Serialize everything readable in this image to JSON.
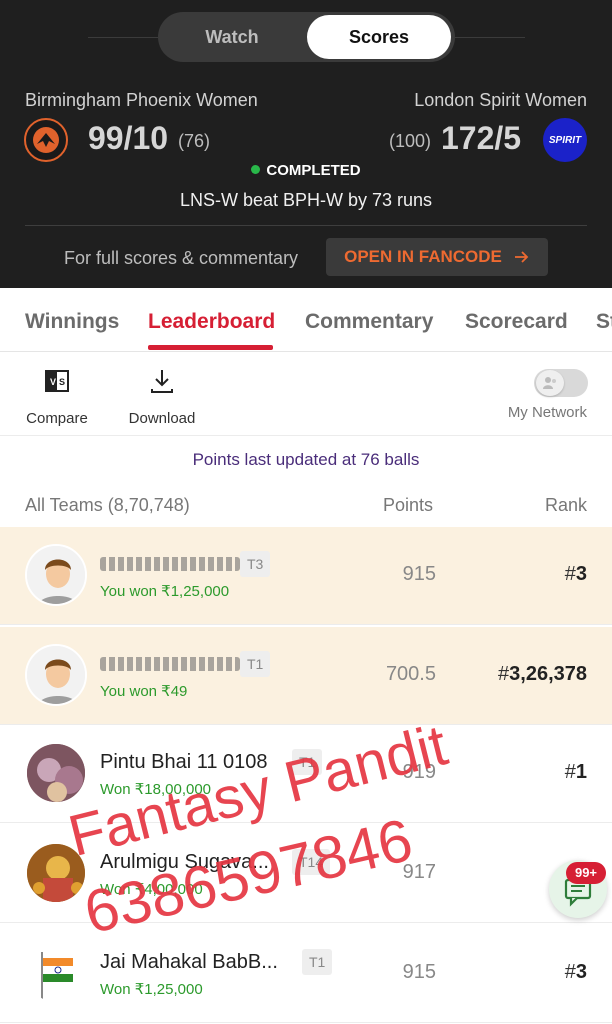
{
  "toggle": {
    "watch": "Watch",
    "scores": "Scores"
  },
  "match": {
    "team1": {
      "name": "Birmingham Phoenix Women",
      "score": "99/10",
      "overs": "(76)",
      "logo_text": "BIRMINGHAM PHOENIX"
    },
    "team2": {
      "name": "London Spirit Women",
      "score": "172/5",
      "overs": "(100)",
      "logo_text": "SPIRIT"
    },
    "status": "COMPLETED",
    "result": "LNS-W beat BPH-W by 73 runs",
    "full_scores_text": "For full scores & commentary",
    "open_btn": "OPEN IN FANCODE",
    "colors": {
      "status_dot": "#29b84a",
      "fancode_orange": "#ee6a31"
    }
  },
  "tabs": [
    {
      "label": "Winnings"
    },
    {
      "label": "Leaderboard"
    },
    {
      "label": "Commentary"
    },
    {
      "label": "Scorecard"
    },
    {
      "label": "St"
    }
  ],
  "toolbar": {
    "compare": "Compare",
    "download": "Download",
    "my_network": "My Network",
    "compare_icon": "vs-icon",
    "download_icon": "download-icon"
  },
  "points_updated": "Points last updated at 76 balls",
  "leaderboard_header": {
    "teams": "All Teams (8,70,748)",
    "points": "Points",
    "rank": "Rank"
  },
  "rows": [
    {
      "team": "",
      "tag": "T3",
      "won": "You won ₹1,25,000",
      "points": "915",
      "rank_prefix": "#",
      "rank": "3"
    },
    {
      "team": "",
      "tag": "T1",
      "won": "You won ₹49",
      "points": "700.5",
      "rank_prefix": "#",
      "rank": "3,26,378"
    },
    {
      "team": "Pintu Bhai 11 0108",
      "tag": "T1",
      "won": "Won ₹18,00,000",
      "points": "919",
      "rank_prefix": "#",
      "rank": "1"
    },
    {
      "team": "Arulmigu Sugava...",
      "tag": "T14",
      "won": "Won ₹4,00,000",
      "points": "917",
      "rank_prefix": "",
      "rank": ""
    },
    {
      "team": "Jai Mahakal BabB...",
      "tag": "T1",
      "won": "Won ₹1,25,000",
      "points": "915",
      "rank_prefix": "#",
      "rank": "3"
    }
  ],
  "watermark": {
    "line1": "Fantasy Pandit",
    "line2": "6386597846"
  },
  "chat": {
    "badge": "99+",
    "icon": "chat-icon"
  },
  "accent": "#d61f34"
}
